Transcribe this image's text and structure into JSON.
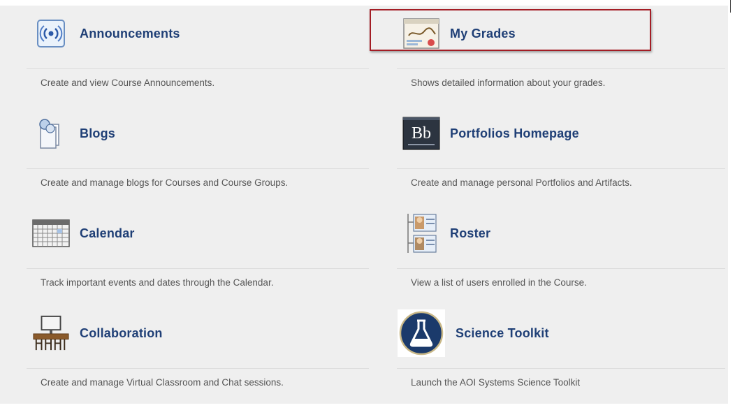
{
  "tools": [
    {
      "key": "announcements",
      "title": "Announcements",
      "description": "Create and view Course Announcements.",
      "icon": "announcement-broadcast-icon"
    },
    {
      "key": "my-grades",
      "title": "My Grades",
      "description": "Shows detailed information about your grades.",
      "icon": "grades-report-icon"
    },
    {
      "key": "blogs",
      "title": "Blogs",
      "description": "Create and manage blogs for Courses and Course Groups.",
      "icon": "blog-icon"
    },
    {
      "key": "portfolios",
      "title": "Portfolios Homepage",
      "description": "Create and manage personal Portfolios and Artifacts.",
      "icon": "blackboard-bb-icon",
      "icon_text": "Bb"
    },
    {
      "key": "calendar",
      "title": "Calendar",
      "description": "Track important events and dates through the Calendar.",
      "icon": "calendar-icon"
    },
    {
      "key": "roster",
      "title": "Roster",
      "description": "View a list of users enrolled in the Course.",
      "icon": "roster-icon"
    },
    {
      "key": "collaboration",
      "title": "Collaboration",
      "description": "Create and manage Virtual Classroom and Chat sessions.",
      "icon": "virtual-classroom-icon"
    },
    {
      "key": "science-toolkit",
      "title": "Science Toolkit",
      "description": "Launch the AOI Systems Science Toolkit",
      "icon": "science-flask-icon"
    }
  ],
  "highlighted_tool": "My Grades",
  "colors": {
    "title": "#1f3f76",
    "highlight_border": "#a31d25",
    "panel_bg": "#efefef"
  }
}
